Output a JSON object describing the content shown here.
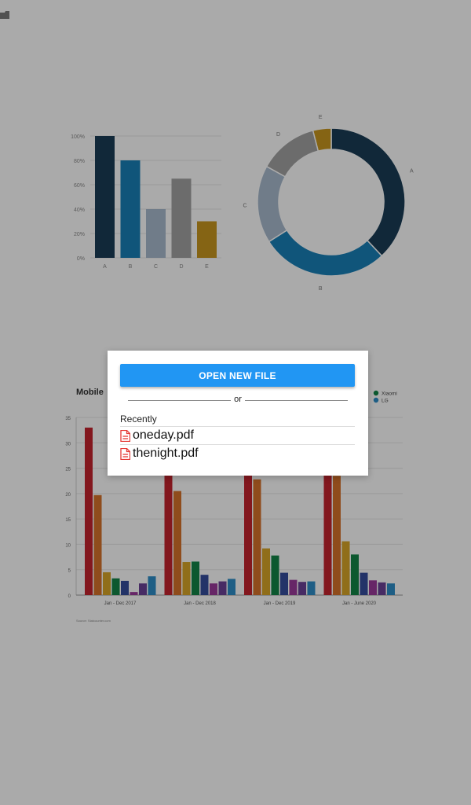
{
  "background": {
    "bar_chart": {
      "type": "bar",
      "categories": [
        "A",
        "B",
        "C",
        "D",
        "E"
      ],
      "values": [
        100,
        80,
        40,
        65,
        30
      ],
      "y_ticks": [
        "0%",
        "20%",
        "40%",
        "60%",
        "80%",
        "100%"
      ],
      "ylim": [
        0,
        100
      ],
      "colors": [
        "#1a3d56",
        "#197fb7",
        "#a7b9cc",
        "#a1a1a1",
        "#c7951e"
      ]
    },
    "donut_chart": {
      "type": "pie",
      "labels": [
        "A",
        "B",
        "C",
        "D",
        "E"
      ],
      "values": [
        38,
        28,
        17,
        13,
        4
      ],
      "colors": [
        "#1a3d56",
        "#197fb7",
        "#a7b9cc",
        "#a1a1a1",
        "#c7951e"
      ]
    },
    "mobile_chart": {
      "type": "bar",
      "title": "Mobile",
      "categories": [
        "Jan - Dec 2017",
        "Jan - Dec 2018",
        "Jan - Dec 2019",
        "Jan - June 2020"
      ],
      "y_ticks": [
        "0",
        "5",
        "10",
        "15",
        "20",
        "25",
        "30",
        "35"
      ],
      "ylim": [
        0,
        35
      ],
      "legend": [
        {
          "name": "Xiaomi",
          "color": "#128446"
        },
        {
          "name": "LG",
          "color": "#2d8dc6"
        }
      ],
      "series_colors": [
        "#c4232e",
        "#d6722a",
        "#d7a528",
        "#128446",
        "#354d9b",
        "#9a3a9a",
        "#6b4196",
        "#2d8dc6"
      ],
      "values": [
        [
          33,
          19.7,
          4.5,
          3.3,
          2.8,
          0.6,
          2.3,
          3.7
        ],
        [
          32.2,
          20.5,
          6.5,
          6.6,
          4.0,
          2.3,
          2.7,
          3.2
        ],
        [
          32.5,
          22.8,
          9.2,
          7.8,
          4.4,
          3.0,
          2.6,
          2.7
        ],
        [
          31.5,
          23.5,
          10.6,
          8.0,
          4.4,
          2.9,
          2.5,
          2.3
        ]
      ],
      "source": "Source: Statcounter.com"
    }
  },
  "dialog": {
    "open_button_label": "OPEN NEW FILE",
    "or_label": "or",
    "recently_label": "Recently",
    "recent_files": [
      "oneday.pdf",
      "thenight.pdf"
    ]
  },
  "colors": {
    "accent": "#2196f3",
    "pdf_icon": "#e53935"
  }
}
